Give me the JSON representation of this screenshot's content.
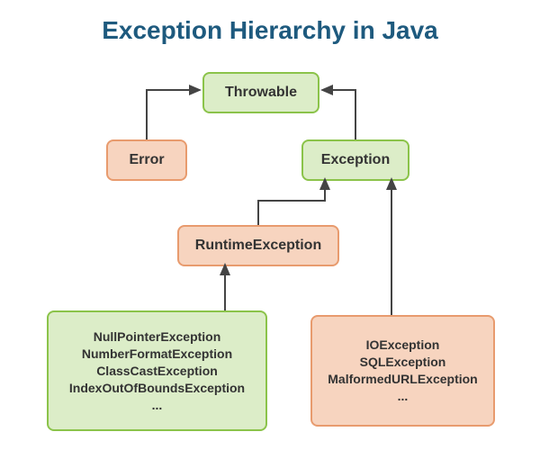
{
  "title": "Exception Hierarchy in Java",
  "nodes": {
    "throwable": "Throwable",
    "error": "Error",
    "exception": "Exception",
    "runtime": "RuntimeException",
    "runtime_subclasses": [
      "NullPointerException",
      "NumberFormatException",
      "ClassCastException",
      "IndexOutOfBoundsException",
      "..."
    ],
    "checked_subclasses": [
      "IOException",
      "SQLException",
      "MalformedURLException",
      "..."
    ]
  }
}
